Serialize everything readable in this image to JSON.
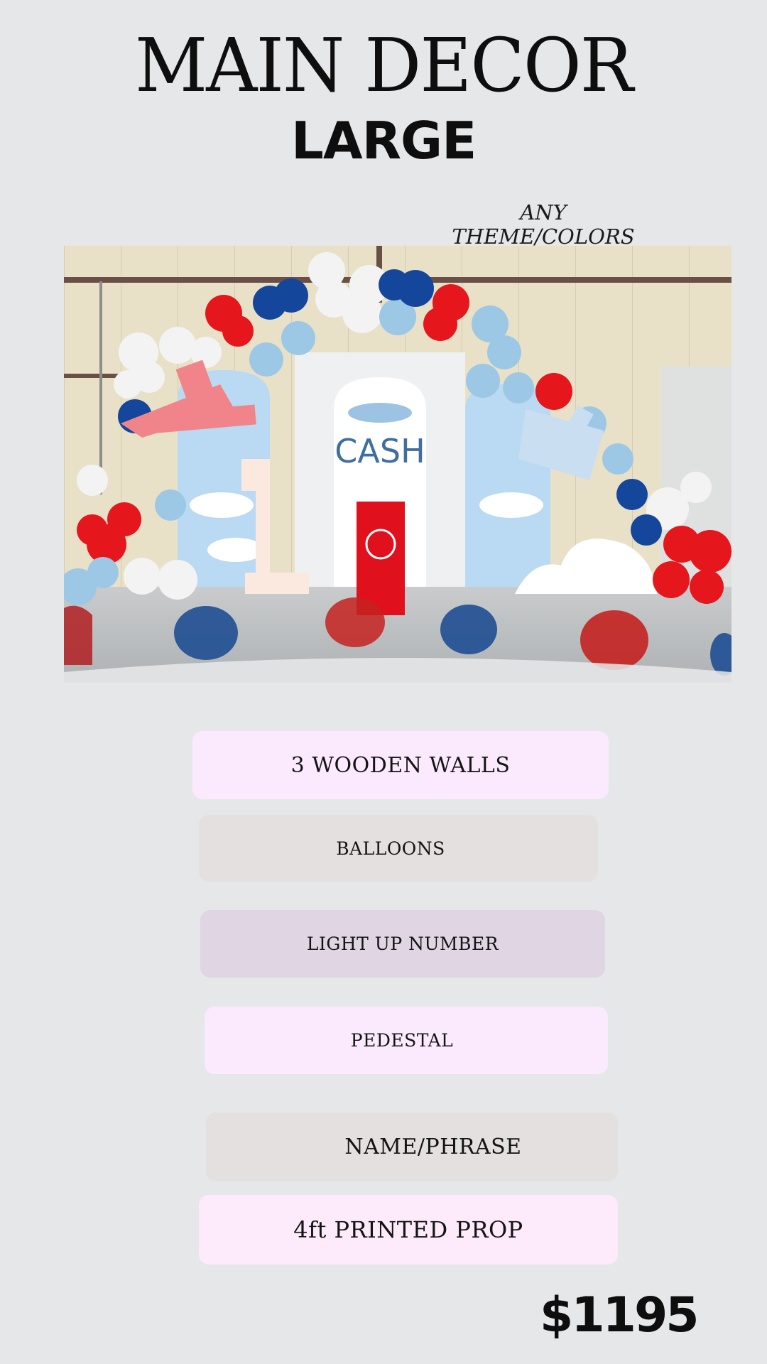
{
  "header": {
    "title": "MAIN DECOR",
    "subtitle": "LARGE",
    "tagline": "ANY THEME/COLORS"
  },
  "photo": {
    "description_icon": "airplane-party-backdrop-image",
    "backdrop_text": "CASH",
    "number": "1"
  },
  "items": [
    {
      "label": "3 WOODEN WALLS",
      "color": "#fbeafd"
    },
    {
      "label": "BALLOONS",
      "color": "#e4e0df"
    },
    {
      "label": "LIGHT UP NUMBER",
      "color": "#e0d5e3"
    },
    {
      "label": "PEDESTAL",
      "color": "#fbeafd"
    },
    {
      "label": "NAME/PHRASE",
      "color": "#e4e0df"
    },
    {
      "label": "4ft PRINTED PROP",
      "color": "#fdebfb"
    }
  ],
  "price": "$1195",
  "colors": {
    "background": "#e6e7e9",
    "balloon_red": "#e5161c",
    "balloon_navy": "#14479c",
    "balloon_sky": "#9cc8e6",
    "balloon_white": "#f3f3f3"
  }
}
